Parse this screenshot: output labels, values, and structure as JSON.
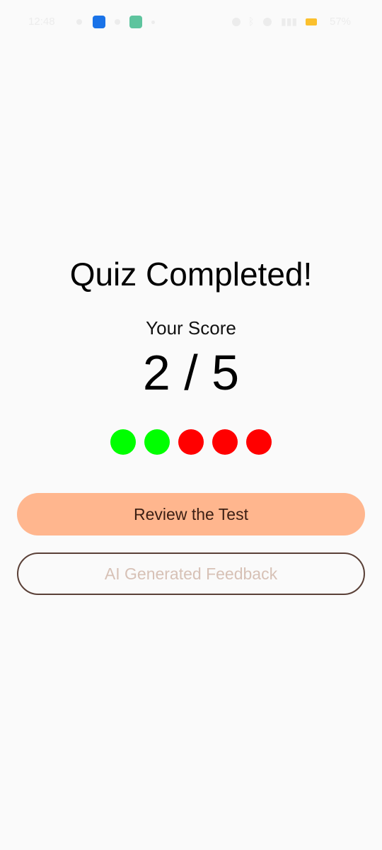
{
  "status_bar": {
    "time": "12:48",
    "battery": "57%",
    "colors": {
      "app_icon_1": "#1a73e8",
      "app_icon_2": "#5ec49e",
      "battery": "#fbc02d"
    }
  },
  "quiz_result": {
    "title": "Quiz Completed!",
    "score_label": "Your Score",
    "score_value": "2 / 5",
    "correct": 2,
    "total": 5,
    "answers": [
      {
        "status": "correct",
        "color": "#00ff00"
      },
      {
        "status": "correct",
        "color": "#00ff00"
      },
      {
        "status": "incorrect",
        "color": "#ff0000"
      },
      {
        "status": "incorrect",
        "color": "#ff0000"
      },
      {
        "status": "incorrect",
        "color": "#ff0000"
      }
    ]
  },
  "actions": {
    "review_label": "Review the Test",
    "feedback_label": "AI Generated Feedback",
    "review_bg": "#ffb68e",
    "feedback_border": "#5a4037"
  }
}
